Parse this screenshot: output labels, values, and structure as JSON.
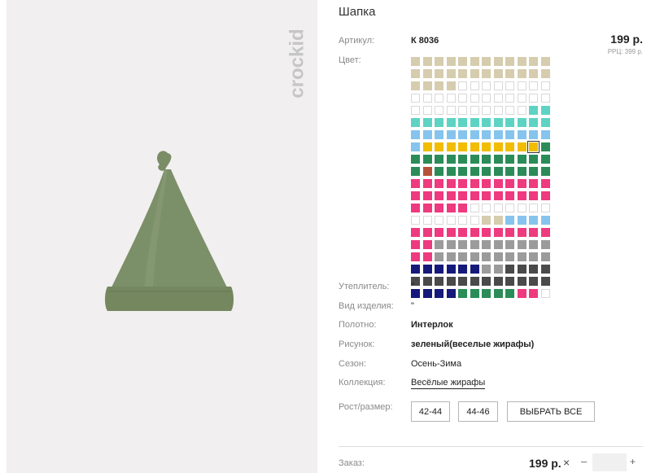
{
  "brand": {
    "logo_text": "crockid"
  },
  "product": {
    "title": "Шапка",
    "article_label": "Артикул:",
    "article_value": "К 8036",
    "price": "199 р.",
    "rrc": "РРЦ: 399 р.",
    "color_label": "Цвет:",
    "insulation_label": "Утеплитель:",
    "insulation_value": "\"",
    "type_label": "Вид изделия:",
    "type_value": "\"",
    "fabric_label": "Полотно:",
    "fabric_value": "Интерлок",
    "print_label": "Рисунок:",
    "print_value": "зеленый(веселые жирафы)",
    "season_label": "Сезон:",
    "season_value": "Осень-Зима",
    "collection_label": "Коллекция:",
    "collection_value": "Весёлые жирафы",
    "size_label": "Рост/размер:",
    "sizes": [
      "42-44",
      "44-46"
    ],
    "select_all": "ВЫБРАТЬ ВСЕ"
  },
  "order": {
    "label": "Заказ:",
    "price": "199 р.",
    "remove": "×",
    "minus": "–",
    "plus": "+"
  },
  "colors": {
    "palette": {
      "b": "#d6ccae",
      "t": "#5ed3c3",
      "l": "#86c4ee",
      "y": "#f2bc00",
      "g": "#2b8c58",
      "r": "#b5533a",
      "p": "#ee3a7f",
      "s": "#9b9b9b",
      "n": "#15197a",
      "d": "#4a4a4a"
    },
    "selected_cell": [
      7,
      10
    ],
    "rows": [
      "bbbbbbbbbbbb",
      "bbbbbbbbbbbb",
      "bbbb........",
      "............",
      "..........tt",
      "tttttttttttt",
      "llllllllllll",
      "lyyyyyyyyyyg",
      "gggggggggggg",
      "grgggggggggg",
      "pppppppppppp",
      "pppppppppppp",
      "ppppp.......",
      "......bbllll",
      "pppppppppppp",
      "ppsssssssssss",
      "ppssssssssss",
      "nnnnnnssdddd",
      "dddddddddddd",
      "nnnngggggpp."
    ]
  }
}
